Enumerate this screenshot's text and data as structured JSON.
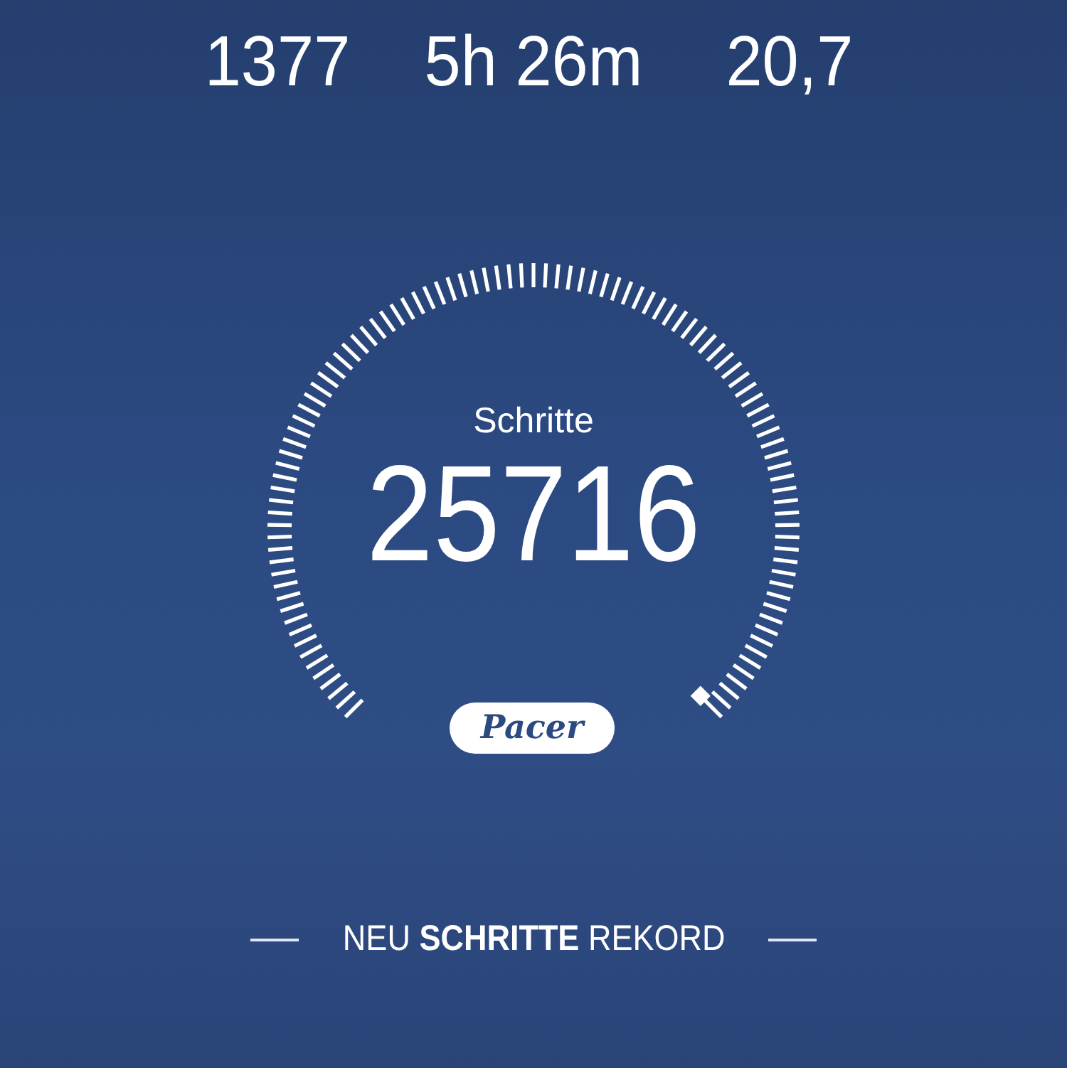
{
  "stats": [
    {
      "value": "1377"
    },
    {
      "value": "5h 26m"
    },
    {
      "value": "20,7"
    }
  ],
  "gauge": {
    "label": "Schritte",
    "value": "25716"
  },
  "logo": "Pacer",
  "banner": "NEU **SCHRITTE** REKORD"
}
